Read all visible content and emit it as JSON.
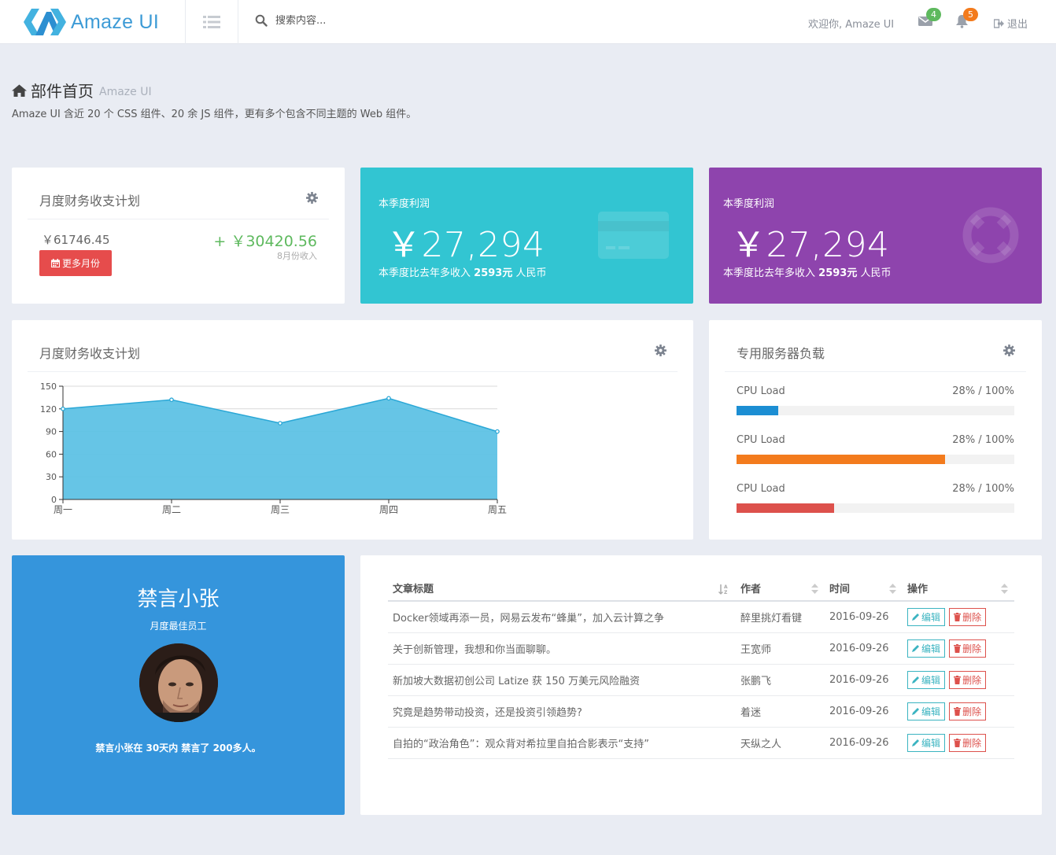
{
  "header": {
    "brand": "Amaze UI",
    "search_placeholder": "搜索内容...",
    "welcome": "欢迎你, Amaze UI",
    "mail_count": "4",
    "notify_count": "5",
    "logout": "退出"
  },
  "page": {
    "title": "部件首页",
    "subtitle": "Amaze UI",
    "description": "Amaze UI 含近 20 个 CSS 组件、20 余 JS 组件，更有多个包含不同主题的 Web 组件。"
  },
  "finance_card": {
    "title": "月度财务收支计划",
    "amount": "￥61746.45",
    "button": "更多月份",
    "income": "+ ￥30420.56",
    "income_label": "8月份收入"
  },
  "tiles": [
    {
      "label": "本季度利润",
      "value": "￥27,294",
      "foot_prefix": "本季度比去年多收入",
      "foot_amount": "2593元",
      "foot_suffix": "人民币",
      "color": "#32c5d2"
    },
    {
      "label": "本季度利润",
      "value": "￥27,294",
      "foot_prefix": "本季度比去年多收入",
      "foot_amount": "2593元",
      "foot_suffix": "人民币",
      "color": "#8e44ad"
    }
  ],
  "chart_card": {
    "title": "月度财务收支计划"
  },
  "chart_data": {
    "type": "area",
    "categories": [
      "周一",
      "周二",
      "周三",
      "周四",
      "周五"
    ],
    "series": [
      {
        "values": [
          120,
          132,
          101,
          134,
          90
        ]
      }
    ],
    "ylim": [
      0,
      150
    ],
    "yticks": [
      0,
      30,
      60,
      90,
      120,
      150
    ],
    "color": "#5ec2e5",
    "line_color": "#2aa7d6",
    "grid": true
  },
  "server_card": {
    "title": "专用服务器负载",
    "items": [
      {
        "label": "CPU Load",
        "pct_text": "28% / 100%",
        "fill": 0.15,
        "color": "#1c8ed3"
      },
      {
        "label": "CPU Load",
        "pct_text": "28% / 100%",
        "fill": 0.75,
        "color": "#f37b1d"
      },
      {
        "label": "CPU Load",
        "pct_text": "28% / 100%",
        "fill": 0.35,
        "color": "#dd514c"
      }
    ]
  },
  "profile": {
    "name": "禁言小张",
    "role": "月度最佳员工",
    "note": "禁言小张在 30天内 禁言了 200多人。"
  },
  "articles": {
    "columns": [
      "文章标题",
      "作者",
      "时间",
      "操作"
    ],
    "edit_label": "编辑",
    "delete_label": "删除",
    "rows": [
      {
        "title": "Docker领域再添一员，网易云发布“蜂巢”，加入云计算之争",
        "author": "醉里挑灯看键",
        "date": "2016-09-26"
      },
      {
        "title": "关于创新管理，我想和你当面聊聊。",
        "author": "王宽师",
        "date": "2016-09-26"
      },
      {
        "title": "新加坡大数据初创公司 Latize 获 150 万美元风险融资",
        "author": "张鹏飞",
        "date": "2016-09-26"
      },
      {
        "title": "究竟是趋势带动投资，还是投资引领趋势?",
        "author": "着迷",
        "date": "2016-09-26"
      },
      {
        "title": "自拍的“政治角色”：观众背对希拉里自拍合影表示“支持”",
        "author": "天纵之人",
        "date": "2016-09-26"
      }
    ]
  }
}
